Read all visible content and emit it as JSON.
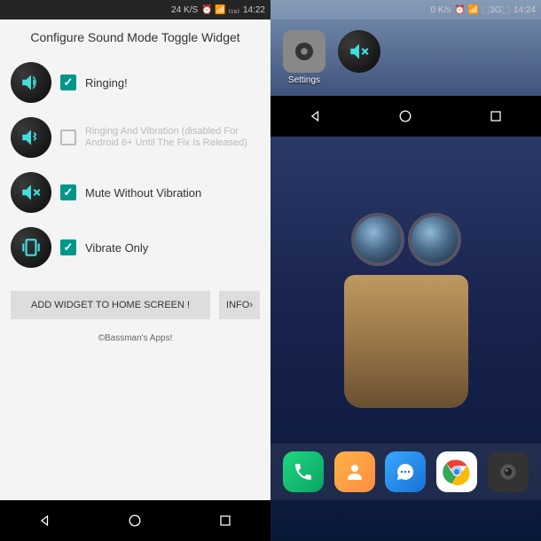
{
  "left": {
    "status": {
      "speed": "24 K/S",
      "extra": "⏰ 📶 ₍₁₅₎",
      "time": "14:22"
    },
    "title": "Configure Sound Mode Toggle Widget",
    "options": [
      {
        "label": "Ringing!",
        "checked": true,
        "disabled": false
      },
      {
        "label": "Ringing And Vibration (disabled For Android 6+ Until The Fix Is Released)",
        "checked": false,
        "disabled": true
      },
      {
        "label": "Mute Without Vibration",
        "checked": true,
        "disabled": false
      },
      {
        "label": "Vibrate Only",
        "checked": true,
        "disabled": false
      }
    ],
    "buttons": {
      "add": "ADD WIDGET TO HOME SCREEN !",
      "info": "INFO›"
    },
    "credit": "©Bassman's Apps!"
  },
  "right": {
    "status": {
      "speed": "0 K/s",
      "extra": "⏰ 📶 ⬚3G⬚",
      "time": "14:24"
    },
    "widgets": [
      {
        "label": "Settings"
      },
      {
        "label": ""
      }
    ],
    "dock": [
      "dialer",
      "contacts",
      "messages",
      "chrome",
      "camera"
    ]
  }
}
